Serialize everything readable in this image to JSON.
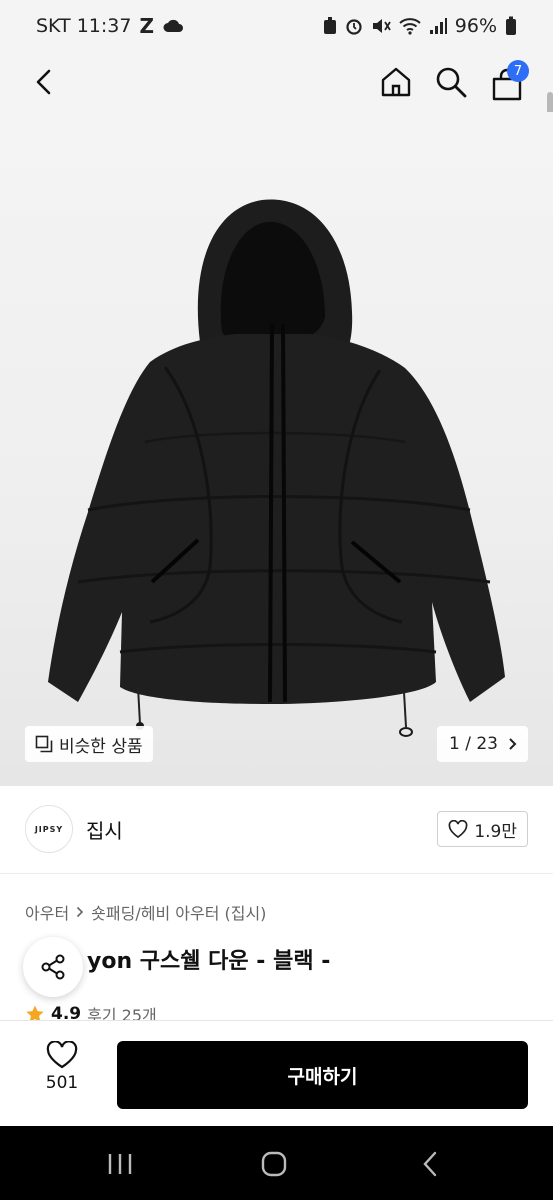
{
  "status": {
    "carrier_time": "SKT 11:37",
    "battery": "96%"
  },
  "cart": {
    "count": "7"
  },
  "image": {
    "similar_label": "비슷한 상품",
    "pager": "1 / 23"
  },
  "brand": {
    "logo_text": "JIPSY",
    "name": "집시",
    "likes": "1.9만"
  },
  "breadcrumb": {
    "level1": "아우터",
    "level2": "숏패딩/헤비 아우터 (집시)"
  },
  "product": {
    "title": "yon 구스쉘 다운 - 블랙 -",
    "rating": "4.9",
    "reviews": "후기 25개"
  },
  "bottom": {
    "wish_count": "501",
    "buy_label": "구매하기"
  },
  "colors": {
    "accent_badge": "#2e6ef7",
    "buy_button": "#000000",
    "star": "#f5a623"
  }
}
